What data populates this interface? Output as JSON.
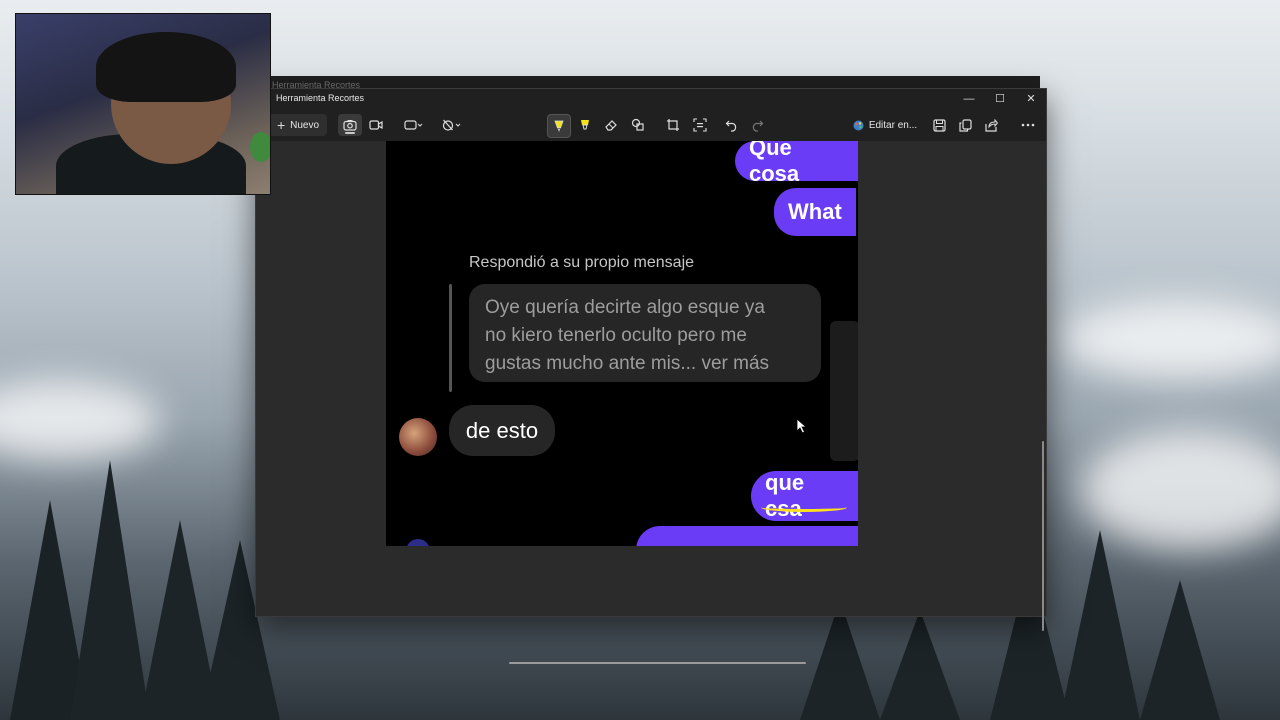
{
  "webcam": {
    "description_icon": "person-icon"
  },
  "ghost_window": {
    "title": "Herramienta Recortes"
  },
  "window": {
    "title": "Herramienta Recortes",
    "controls": {
      "minimize": "—",
      "maximize": "☐",
      "close": "✕"
    }
  },
  "toolbar": {
    "new_label": "Nuevo",
    "edit_in_label": "Editar en...",
    "icons": {
      "screenshot": "camera-icon",
      "record": "video-icon",
      "shape": "rectangle-mode-icon",
      "delay": "timer-off-icon",
      "pen": "ballpoint-pen-icon",
      "highlighter": "highlighter-icon",
      "eraser": "eraser-icon",
      "shapes": "shapes-icon",
      "crop": "crop-icon",
      "text_actions": "text-actions-icon",
      "undo": "undo-icon",
      "redo": "redo-icon",
      "paint": "paint-icon",
      "save": "save-icon",
      "copy": "copy-icon",
      "share": "share-icon",
      "more": "more-icon"
    }
  },
  "capture": {
    "messages_out_top": [
      "Que cosa",
      "What"
    ],
    "reply_label": "Respondió a su propio mensaje",
    "quoted_lines": [
      "Oye quería decirte algo esque ya",
      "no kiero tenerlo oculto pero me",
      "gustas mucho ante mis... ver más"
    ],
    "message_in": "de esto",
    "message_out_bottom": "que csa"
  },
  "colors": {
    "accent_bubble": "#6a3cf5",
    "highlighter": "#ffe11a"
  }
}
